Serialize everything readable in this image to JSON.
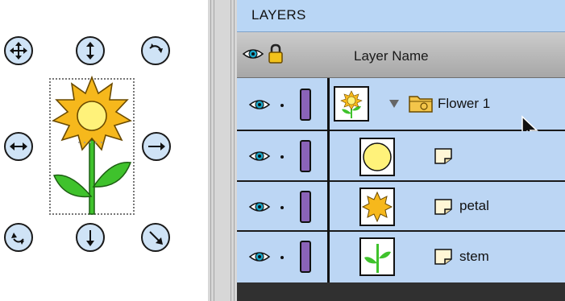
{
  "panel": {
    "title": "LAYERS",
    "column_header": "Layer Name"
  },
  "layers": [
    {
      "name": "Flower 1",
      "type": "group",
      "expanded": true,
      "visible": true,
      "color": "#8a63b8"
    },
    {
      "name": "",
      "type": "symbol",
      "visible": true,
      "color": "#8a63b8"
    },
    {
      "name": "petal",
      "type": "symbol",
      "visible": true,
      "color": "#8a63b8"
    },
    {
      "name": "stem",
      "type": "symbol",
      "visible": true,
      "color": "#8a63b8"
    }
  ],
  "colors": {
    "panel_title_bg": "#b9d6f5",
    "row_bg": "#bcd6f4",
    "handle_fill": "#cfe3f6",
    "layer_color": "#8a63b8",
    "flower_petal": "#f6b81c",
    "flower_center": "#fff27a",
    "stem_green": "#3fc22c"
  },
  "icons": {
    "handles": [
      "move-icon",
      "resize-vertical-icon",
      "rotate-icon",
      "resize-horizontal-icon",
      "resize-diagonal-icon"
    ],
    "row": [
      "eye-icon",
      "lock-icon",
      "folder-icon",
      "disclosure-triangle-icon",
      "symbol-page-icon",
      "cursor-arrow-icon"
    ]
  }
}
